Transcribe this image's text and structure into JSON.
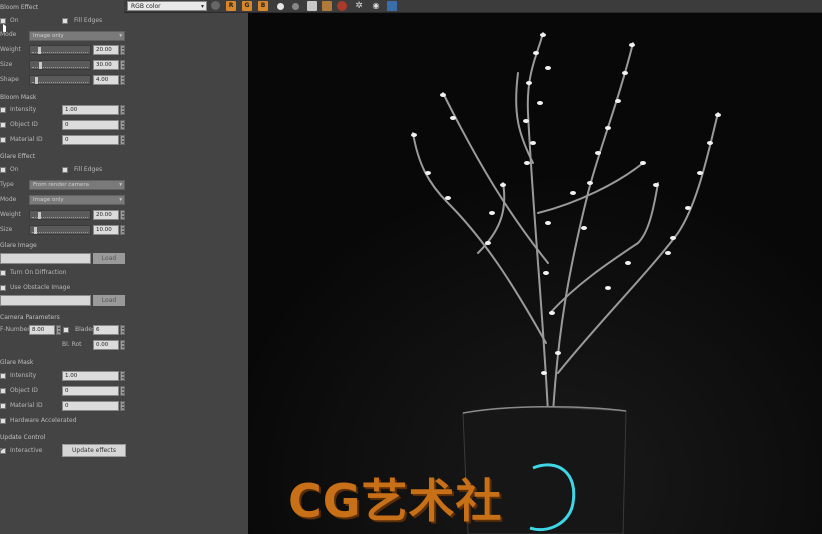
{
  "toolbar": {
    "channel_select": "RGB color",
    "btn_r": "R",
    "btn_g": "G",
    "btn_b": "B"
  },
  "bloom_effect": {
    "header": "Bloom Effect",
    "on_label": "On",
    "fill_edges_label": "Fill Edges",
    "mode_label": "Mode",
    "mode_value": "Image only",
    "weight_label": "Weight",
    "weight_value": "20.00",
    "weight_frac": 0.1,
    "size_label": "Size",
    "size_value": "30.00",
    "size_frac": 0.12,
    "shape_label": "Shape",
    "shape_value": "4.00",
    "shape_frac": 0.05
  },
  "bloom_mask": {
    "header": "Bloom Mask",
    "intensity_label": "Intensity",
    "intensity_value": "1.00",
    "object_id_label": "Object ID",
    "object_id_value": "0",
    "material_id_label": "Material ID",
    "material_id_value": "0"
  },
  "glare_effect": {
    "header": "Glare Effect",
    "on_label": "On",
    "fill_edges_label": "Fill Edges",
    "type_label": "Type",
    "type_value": "From render camera",
    "mode_label": "Mode",
    "mode_value": "Image only",
    "weight_label": "Weight",
    "weight_value": "20.00",
    "weight_frac": 0.1,
    "size_label": "Size",
    "size_value": "10.00",
    "size_frac": 0.04
  },
  "glare_image": {
    "header": "Glare Image",
    "load_label": "Load",
    "turn_on_diffraction_label": "Turn On Diffraction",
    "use_obstacle_label": "Use Obstacle Image",
    "load2_label": "Load"
  },
  "camera_parameters": {
    "header": "Camera Parameters",
    "fnumber_label": "F-Number",
    "fnumber_value": "8.00",
    "blades_label": "Blades",
    "blades_value": "6",
    "bl_rot_label": "Bl. Rot",
    "bl_rot_value": "0.00"
  },
  "glare_mask": {
    "header": "Glare Mask",
    "intensity_label": "Intensity",
    "intensity_value": "1.00",
    "object_id_label": "Object ID",
    "object_id_value": "0",
    "material_id_label": "Material ID",
    "material_id_value": "0",
    "hardware_label": "Hardware Accelerated"
  },
  "update_control": {
    "header": "Update Control",
    "interactive_label": "Interactive",
    "update_button": "Update effects"
  },
  "viewport": {
    "watermark": "CG艺术社"
  },
  "colors": {
    "accent_orange": "#d8862a",
    "panel_bg": "#444444",
    "viewport_bg": "#0b0b0b",
    "cyan_glow": "#3fd6e6"
  }
}
